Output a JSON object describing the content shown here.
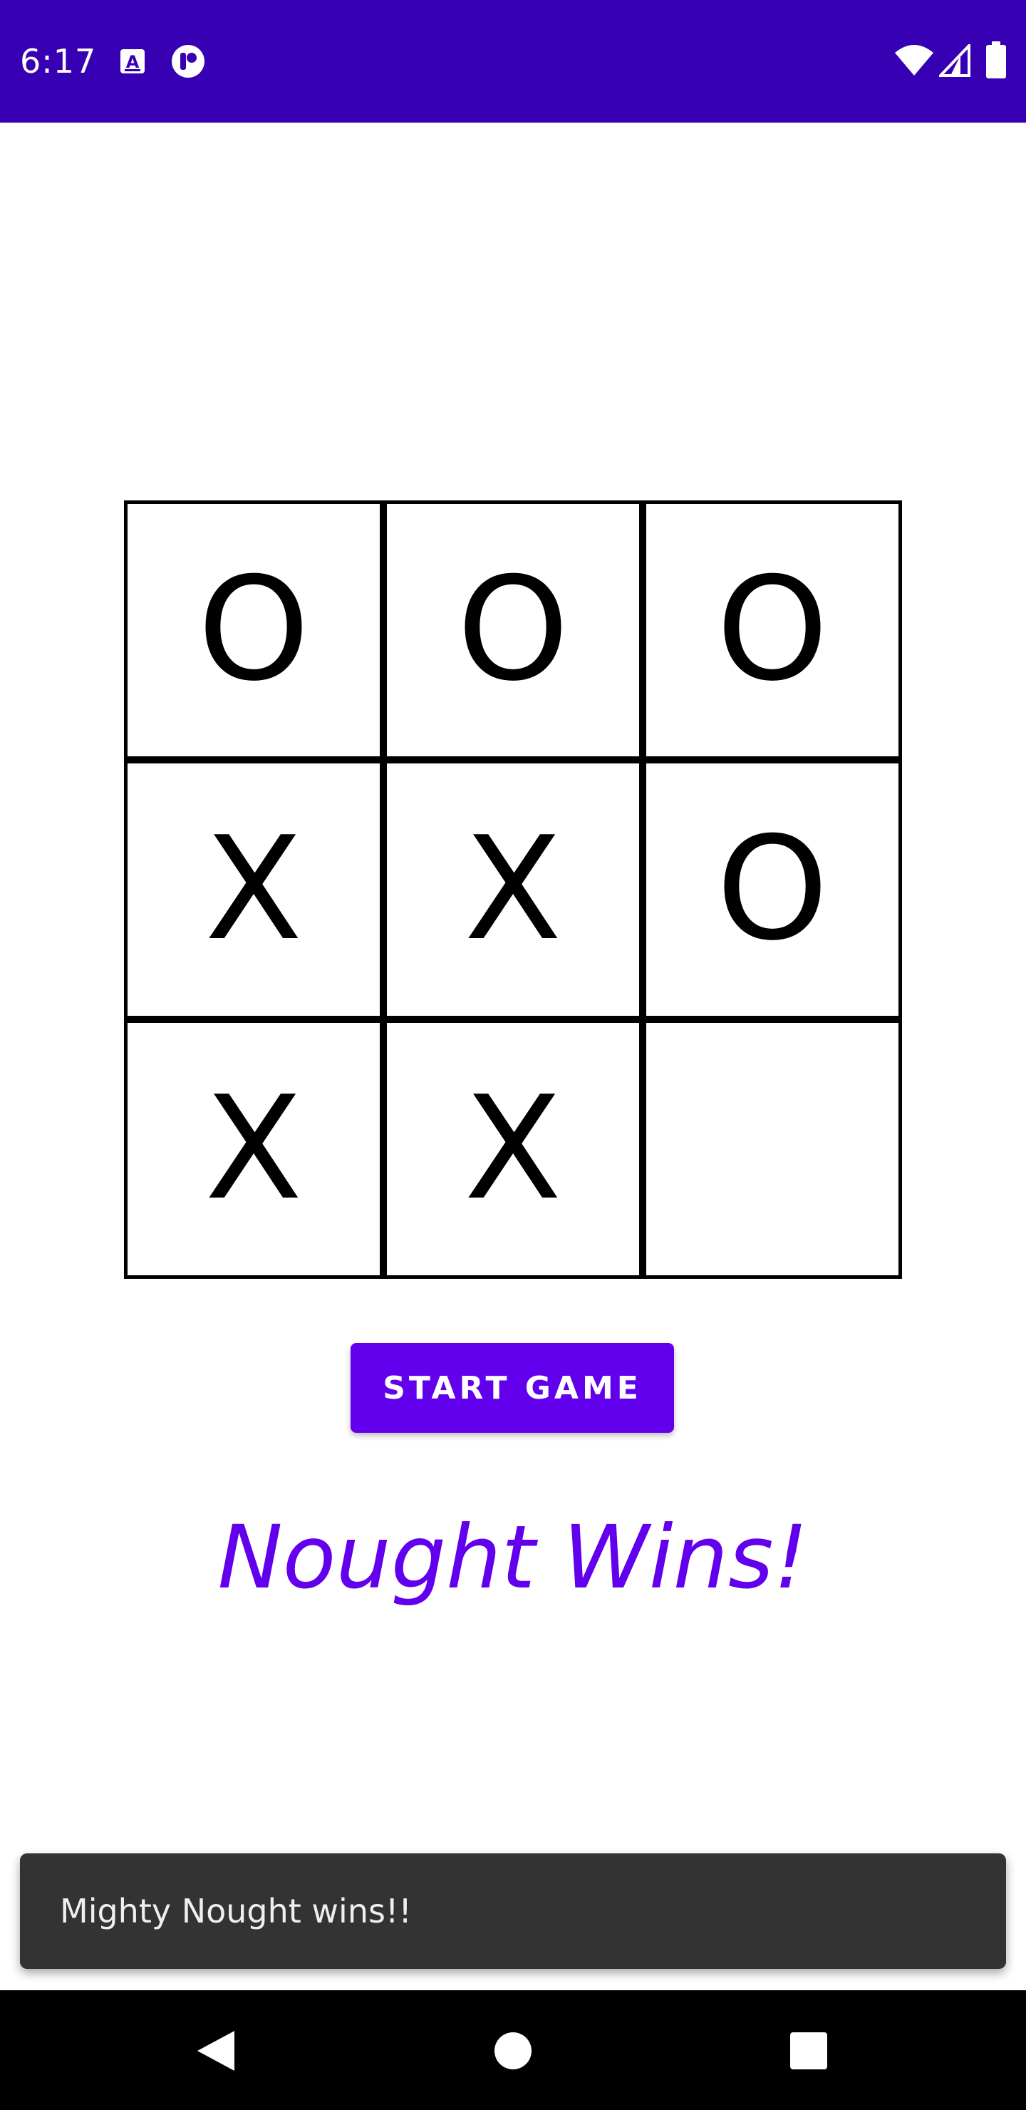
{
  "status_bar": {
    "time": "6:17",
    "icons_left": [
      "a-letter-icon",
      "app-notification-icon"
    ],
    "icons_right": [
      "wifi-icon",
      "cell-signal-icon",
      "battery-icon"
    ],
    "background": "#3700b3"
  },
  "board": {
    "cells": [
      "O",
      "O",
      "O",
      "X",
      "X",
      "O",
      "X",
      "X",
      ""
    ]
  },
  "start_button": {
    "label": "START GAME",
    "color": "#6200ee"
  },
  "result_text": "Nought Wins!",
  "snackbar": {
    "message": "Mighty Nought wins!!"
  },
  "nav_bar": {
    "icons": [
      "back-icon",
      "home-icon",
      "recents-icon"
    ]
  }
}
